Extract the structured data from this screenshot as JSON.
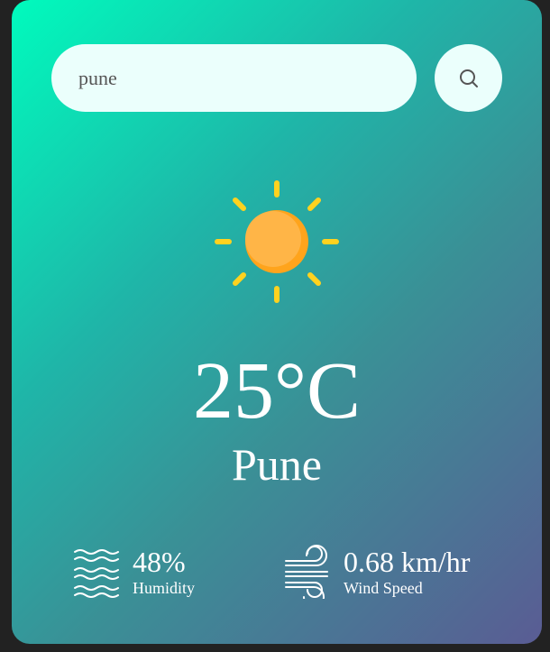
{
  "search": {
    "value": "pune",
    "button_icon": "search-icon"
  },
  "weather": {
    "icon": "sun-icon",
    "temperature": "25°C",
    "city": "Pune"
  },
  "details": {
    "humidity": {
      "icon": "humidity-icon",
      "value": "48%",
      "label": "Humidity"
    },
    "wind": {
      "icon": "wind-icon",
      "value": "0.68 km/hr",
      "label": "Wind Speed"
    }
  },
  "colors": {
    "page_background": "#222222",
    "card_gradient_start": "#00fbbd",
    "card_gradient_end": "#5a5c94",
    "input_background": "#ebfffc",
    "sun_body": "#ffb13d",
    "sun_rays": "#ffd21f",
    "text": "#ffffff"
  }
}
